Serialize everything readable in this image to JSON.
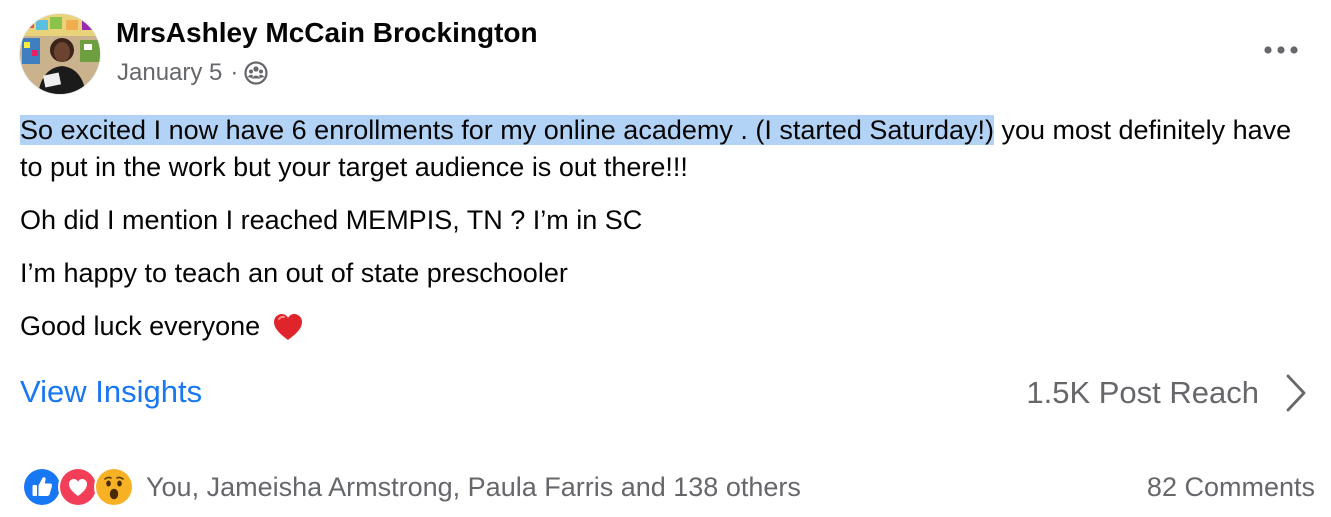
{
  "post": {
    "author": "MrsAshley McCain Brockington",
    "date": "January 5",
    "separator": "·",
    "audience_icon": "friends-audience-icon",
    "more_icon": "more-options-icon",
    "body": {
      "line1_highlighted": "So excited I now have 6 enrollments for my online academy . (I started Saturday!)",
      "line1_rest": " you most definitely have to put in the work but your target audience is out there!!!",
      "paragraph2": "Oh did I mention I reached MEMPIS, TN ? I’m in SC",
      "paragraph3": "I’m happy to teach an out of state preschooler",
      "paragraph4": "Good luck everyone",
      "paragraph4_emoji": "red-heart-emoji"
    },
    "insights": {
      "view_insights_label": "View Insights",
      "reach_label": "1.5K Post Reach",
      "chevron_icon": "chevron-right-icon"
    },
    "footer": {
      "reaction_icons": [
        "like-icon",
        "love-icon",
        "wow-icon"
      ],
      "reactors_text": "You, Jameisha Armstrong, Paula Farris and 138 others",
      "comments_text": "82 Comments"
    },
    "colors": {
      "link_blue": "#1877f2",
      "secondary_text": "#65676b",
      "highlight": "#b3d3f6",
      "like_blue": "#1877f2",
      "love_red": "#f33e58",
      "wow_yellow": "#f7b125"
    }
  }
}
